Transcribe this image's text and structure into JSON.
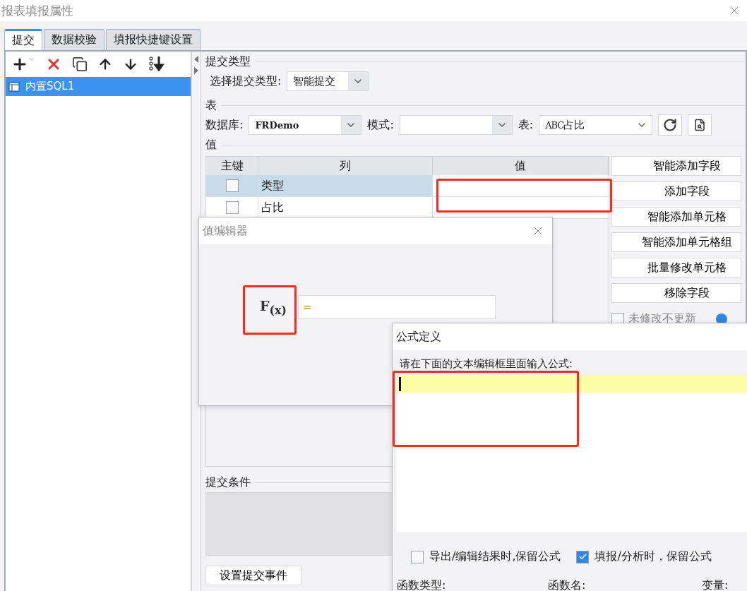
{
  "window": {
    "title": "报表填报属性"
  },
  "tabs": [
    {
      "label": "提交",
      "selected": true
    },
    {
      "label": "数据校验",
      "selected": false
    },
    {
      "label": "填报快捷键设置",
      "selected": false
    }
  ],
  "sidebar": {
    "items": [
      {
        "label": "内置SQL1",
        "selected": true
      }
    ]
  },
  "submit_type": {
    "heading": "提交类型",
    "label": "选择提交类型:",
    "value": "智能提交"
  },
  "table_section": {
    "heading": "表",
    "database_label": "数据库:",
    "database": "FRDemo",
    "schema_label": "模式:",
    "table_label": "表:",
    "table_type": "ABC",
    "table": "占比"
  },
  "values_section": {
    "heading": "值",
    "columns": [
      "主键",
      "列",
      "值"
    ],
    "rows": [
      {
        "key": false,
        "column": "类型",
        "selected": true,
        "value_highlighted": true
      },
      {
        "key": false,
        "column": "占比",
        "selected": false,
        "value_highlighted": false
      }
    ]
  },
  "buttons": [
    "智能添加字段",
    "添加字段",
    "智能添加单元格",
    "智能添加单元格组",
    "批量修改单元格",
    "移除字段"
  ],
  "no_update": {
    "label": "未修改不更新",
    "checked": false
  },
  "condition": {
    "heading": "提交条件"
  },
  "event_button": "设置提交事件",
  "value_editor": {
    "title": "值编辑器",
    "fx_label": "F$_{(x)}$",
    "fx_highlighted": true,
    "value": "="
  },
  "formula_dialog": {
    "title": "公式定义",
    "prompt": "请在下面的文本编辑框里面输入公式:",
    "editor_highlighted": true,
    "options": [
      {
        "label": "导出/编辑结果时,保留公式",
        "checked": false
      },
      {
        "label": "填报/分析时，保留公式",
        "checked": true
      }
    ],
    "footer_labels": [
      "函数类型:",
      "函数名:",
      "变量:"
    ]
  }
}
